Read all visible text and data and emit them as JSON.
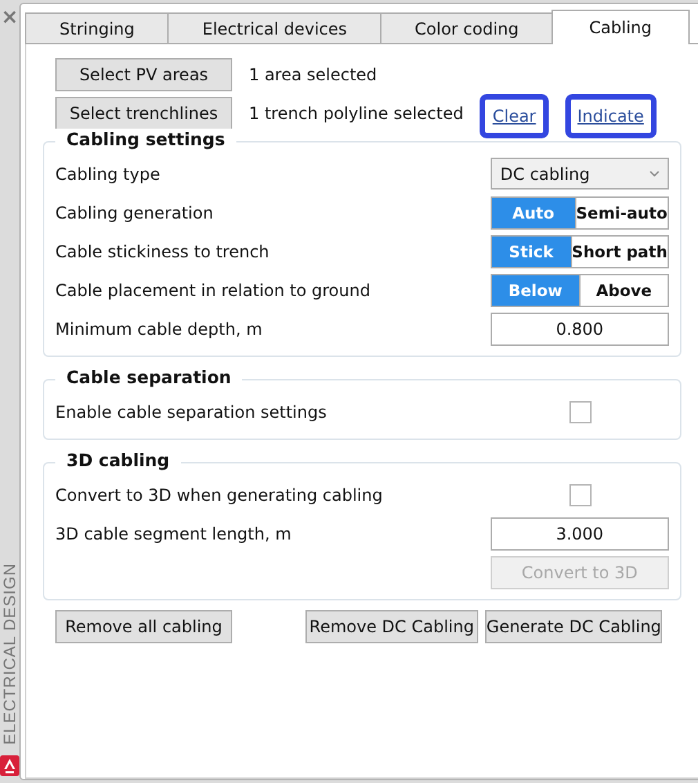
{
  "sidebar": {
    "close": "×",
    "title": "ELECTRICAL DESIGN"
  },
  "tabs": [
    {
      "label": "Stringing",
      "selected": false
    },
    {
      "label": "Electrical devices",
      "selected": false
    },
    {
      "label": "Color coding",
      "selected": false
    },
    {
      "label": "Cabling",
      "selected": true
    }
  ],
  "selection": [
    {
      "button": "Select PV areas",
      "status": "1 area selected"
    },
    {
      "button": "Select trenchlines",
      "status": "1 trench polyline selected",
      "links": [
        {
          "label": "Clear",
          "highlighted": true
        },
        {
          "label": "Indicate",
          "highlighted": true
        }
      ]
    }
  ],
  "groups": [
    {
      "title": "Cabling settings",
      "rows": [
        {
          "kind": "dropdown",
          "label": "Cabling type",
          "value": "DC cabling"
        },
        {
          "kind": "toggle",
          "label": "Cabling generation",
          "options": [
            {
              "label": "Auto",
              "selected": true
            },
            {
              "label": "Semi-auto",
              "selected": false
            }
          ]
        },
        {
          "kind": "toggle",
          "label": "Cable stickiness to trench",
          "options": [
            {
              "label": "Stick",
              "selected": true
            },
            {
              "label": "Short path",
              "selected": false
            }
          ]
        },
        {
          "kind": "toggle",
          "label": "Cable placement in relation to ground",
          "options": [
            {
              "label": "Below",
              "selected": true
            },
            {
              "label": "Above",
              "selected": false
            }
          ]
        },
        {
          "kind": "number",
          "label": "Minimum cable depth, m",
          "value": "0.800"
        }
      ]
    },
    {
      "title": "Cable separation",
      "rows": [
        {
          "kind": "checkbox",
          "label": "Enable cable separation settings",
          "checked": false
        }
      ]
    },
    {
      "title": "3D cabling",
      "rows": [
        {
          "kind": "checkbox",
          "label": "Convert to 3D when generating cabling",
          "checked": false
        },
        {
          "kind": "number",
          "label": "3D cable segment length, m",
          "value": "3.000"
        },
        {
          "kind": "button",
          "label": "Convert to 3D",
          "disabled": true
        }
      ]
    }
  ],
  "actions": [
    {
      "label": "Remove all cabling"
    },
    {
      "label": "Remove DC Cabling"
    },
    {
      "label": "Generate DC Cabling"
    }
  ]
}
